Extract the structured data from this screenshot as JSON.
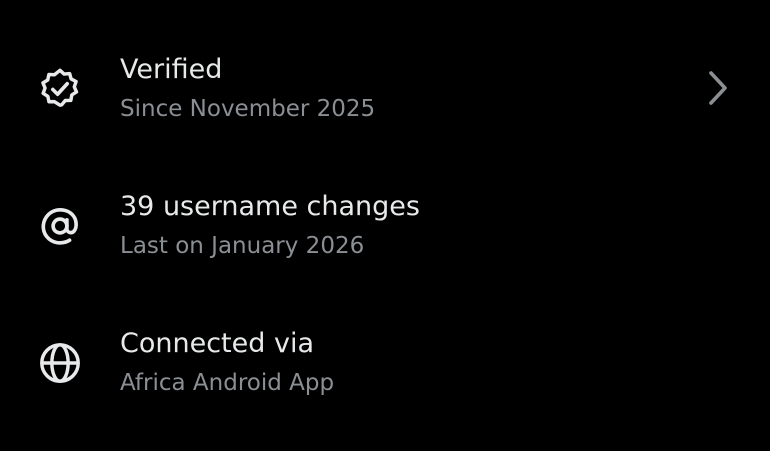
{
  "items": [
    {
      "title": "Verified",
      "subtitle": "Since November 2025",
      "icon": "verified-badge-icon",
      "has_chevron": true
    },
    {
      "title": "39 username changes",
      "subtitle": "Last on January 2026",
      "icon": "at-sign-icon",
      "has_chevron": false
    },
    {
      "title": "Connected via",
      "subtitle": "Africa Android App",
      "icon": "globe-icon",
      "has_chevron": false
    }
  ],
  "colors": {
    "background": "#000000",
    "primary_text": "#e7e9ea",
    "secondary_text": "#8b8f93",
    "chevron": "#8b8f93"
  }
}
